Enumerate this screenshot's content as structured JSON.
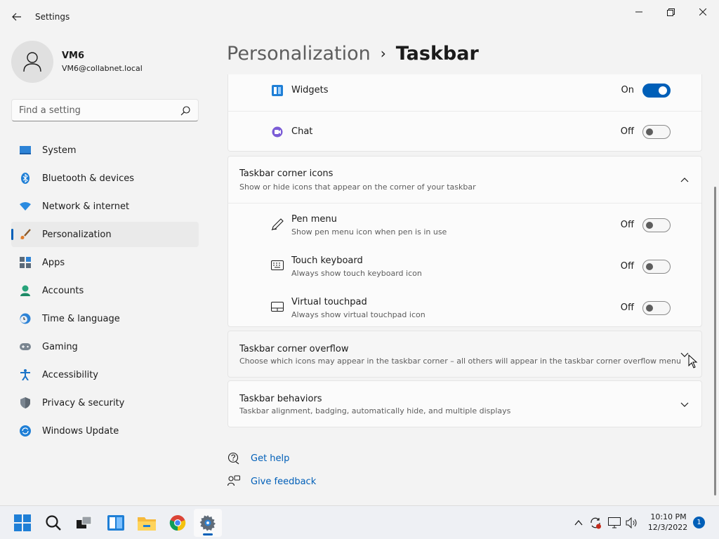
{
  "window": {
    "title": "Settings"
  },
  "profile": {
    "name": "VM6",
    "email": "VM6@collabnet.local"
  },
  "search": {
    "placeholder": "Find a setting"
  },
  "nav": {
    "items": [
      {
        "label": "System",
        "icon": "monitor-icon"
      },
      {
        "label": "Bluetooth & devices",
        "icon": "bluetooth-icon"
      },
      {
        "label": "Network & internet",
        "icon": "wifi-icon"
      },
      {
        "label": "Personalization",
        "icon": "brush-icon",
        "active": true
      },
      {
        "label": "Apps",
        "icon": "apps-icon"
      },
      {
        "label": "Accounts",
        "icon": "person-icon"
      },
      {
        "label": "Time & language",
        "icon": "clock-globe-icon"
      },
      {
        "label": "Gaming",
        "icon": "gamepad-icon"
      },
      {
        "label": "Accessibility",
        "icon": "accessibility-icon"
      },
      {
        "label": "Privacy & security",
        "icon": "shield-icon"
      },
      {
        "label": "Windows Update",
        "icon": "update-icon"
      }
    ]
  },
  "header": {
    "parent": "Personalization",
    "separator": "›",
    "current": "Taskbar"
  },
  "taskbar_items_card": {
    "rows": [
      {
        "title": "Widgets",
        "state": "On",
        "on": true
      },
      {
        "title": "Chat",
        "state": "Off",
        "on": false
      }
    ]
  },
  "corner_icons": {
    "title": "Taskbar corner icons",
    "subtitle": "Show or hide icons that appear on the corner of your taskbar",
    "rows": [
      {
        "title": "Pen menu",
        "subtitle": "Show pen menu icon when pen is in use",
        "state": "Off",
        "on": false
      },
      {
        "title": "Touch keyboard",
        "subtitle": "Always show touch keyboard icon",
        "state": "Off",
        "on": false
      },
      {
        "title": "Virtual touchpad",
        "subtitle": "Always show virtual touchpad icon",
        "state": "Off",
        "on": false
      }
    ]
  },
  "corner_overflow": {
    "title": "Taskbar corner overflow",
    "subtitle": "Choose which icons may appear in the taskbar corner – all others will appear in the taskbar corner overflow menu"
  },
  "behaviors": {
    "title": "Taskbar behaviors",
    "subtitle": "Taskbar alignment, badging, automatically hide, and multiple displays"
  },
  "help": {
    "get_help": "Get help",
    "give_feedback": "Give feedback"
  },
  "tray": {
    "time": "10:10 PM",
    "date": "12/3/2022",
    "notifications": "1"
  },
  "colors": {
    "accent": "#005fb8"
  }
}
